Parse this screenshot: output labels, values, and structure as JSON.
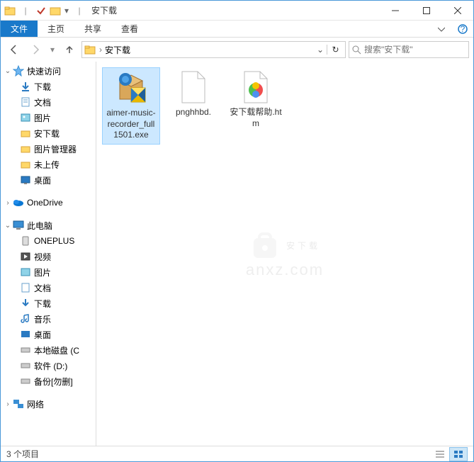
{
  "window": {
    "title": "安下载"
  },
  "ribbon": {
    "file": "文件",
    "tabs": [
      "主页",
      "共享",
      "查看"
    ]
  },
  "address": {
    "path": "安下载"
  },
  "search": {
    "placeholder": "搜索\"安下载\""
  },
  "sidebar": {
    "quick_access": "快速访问",
    "quick_items": [
      "下载",
      "文档",
      "图片",
      "安下载",
      "图片管理器",
      "未上传",
      "桌面"
    ],
    "onedrive": "OneDrive",
    "this_pc": "此电脑",
    "pc_items": [
      "ONEPLUS",
      "视频",
      "图片",
      "文档",
      "下载",
      "音乐",
      "桌面",
      "本地磁盘 (C",
      "软件 (D:)",
      "备份[勿删]"
    ],
    "network": "网络"
  },
  "files": {
    "items": [
      {
        "name": "aimer-music-recorder_full1501.exe"
      },
      {
        "name": "pnghhbd."
      },
      {
        "name": "安下载帮助.htm"
      }
    ]
  },
  "status": {
    "count": "3 个项目"
  },
  "watermark": {
    "top": "安下载",
    "bottom": "anxz.com"
  }
}
